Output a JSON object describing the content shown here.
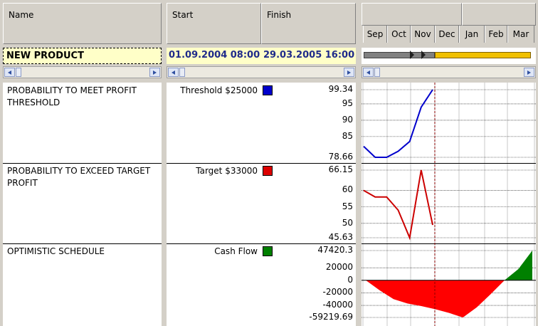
{
  "columns": {
    "name": "Name",
    "start": "Start",
    "finish": "Finish"
  },
  "months": [
    "Sep",
    "Oct",
    "Nov",
    "Dec",
    "Jan",
    "Feb",
    "Mar"
  ],
  "project": {
    "name": "NEW PRODUCT",
    "start": "01.09.2004  08:00",
    "finish": "29.03.2005  16:00"
  },
  "rows": [
    {
      "name": "PROBABILITY TO MEET PROFIT THRESHOLD",
      "legend": "Threshold $25000",
      "color": "#0000cc"
    },
    {
      "name": "PROBABILITY TO EXCEED TARGET PROFIT",
      "legend": "Target $33000",
      "color": "#dd0000"
    },
    {
      "name": "OPTIMISTIC SCHEDULE",
      "legend": "Cash Flow",
      "color": "#008000"
    }
  ],
  "chart_data": [
    {
      "type": "line",
      "series": [
        {
          "name": "Threshold $25000",
          "color": "#0000cc",
          "values": [
            82,
            78.66,
            78.66,
            80.5,
            83.5,
            94,
            99.34
          ]
        }
      ],
      "y_ticks": [
        "99.34",
        "95",
        "90",
        "85",
        "78.66"
      ],
      "ylim": [
        78.66,
        99.34
      ]
    },
    {
      "type": "line",
      "series": [
        {
          "name": "Target $33000",
          "color": "#cc0000",
          "values": [
            60,
            58,
            58,
            54,
            45.63,
            66.15,
            49.5
          ]
        }
      ],
      "y_ticks": [
        "66.15",
        "60",
        "55",
        "50",
        "45.63"
      ],
      "ylim": [
        45.63,
        66.15
      ]
    },
    {
      "type": "area",
      "series": [
        {
          "name": "Cash Flow",
          "negative_color": "#ff0000",
          "positive_color": "#008000",
          "values": [
            0,
            -16000,
            -30000,
            -37000,
            -41000,
            -46000,
            -52000,
            -59219.69,
            -43000,
            -22000,
            0,
            18000,
            47420.3
          ]
        }
      ],
      "y_ticks": [
        "47420.3",
        "20000",
        "0",
        "-20000",
        "-40000",
        "-59219.69"
      ],
      "ylim": [
        -59219.69,
        47420.3
      ]
    }
  ]
}
